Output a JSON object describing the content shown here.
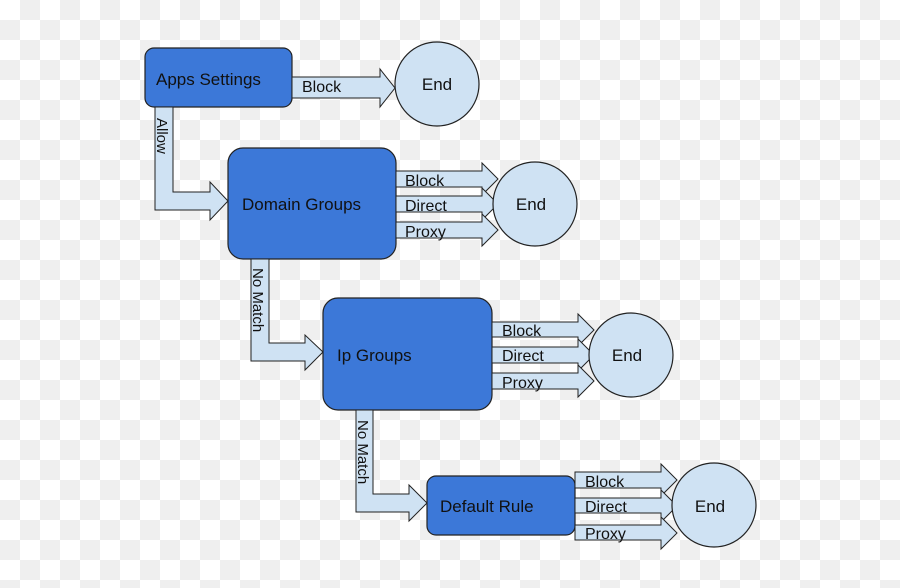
{
  "colors": {
    "node_fill": "#3c78d8",
    "arrow_fill": "#cfe2f3",
    "end_fill": "#cfe2f3",
    "stroke": "#222222"
  },
  "nodes": {
    "apps_settings": "Apps Settings",
    "domain_groups": "Domain Groups",
    "ip_groups": "Ip Groups",
    "default_rule": "Default Rule"
  },
  "end_label": "End",
  "edges": {
    "allow": "Allow",
    "no_match": "No Match",
    "block": "Block",
    "direct": "Direct",
    "proxy": "Proxy"
  }
}
